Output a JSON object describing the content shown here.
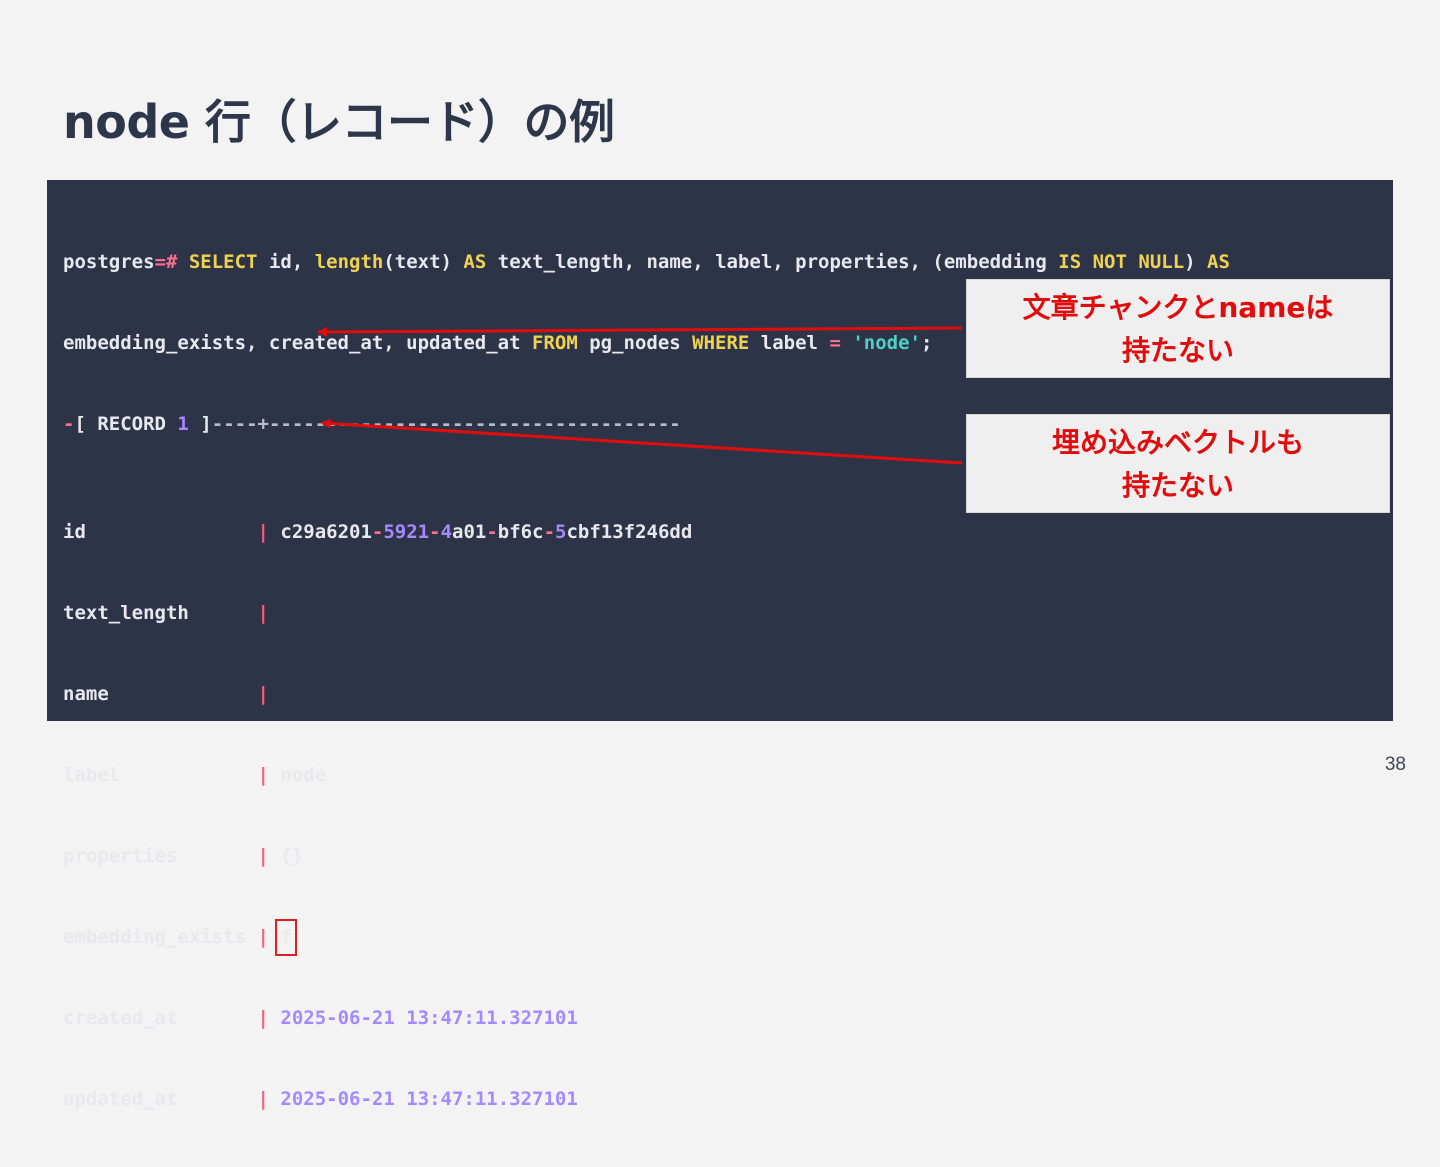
{
  "slide": {
    "title": "node 行（レコード）の例",
    "page_number": "38"
  },
  "terminal": {
    "prompt": "postgres",
    "prompt_op": "=#",
    "query": {
      "select": "SELECT",
      "cols1": " id, ",
      "length": "length",
      "cols2": "(text) ",
      "as1": "AS",
      "cols3": " text_length, name, label, properties, (embedding ",
      "is": "IS",
      "not": "NOT",
      "null": "NULL",
      "paren": ") ",
      "as2": "AS",
      "line2a": "embedding_exists, created_at, updated_at ",
      "from": "FROM",
      "table": " pg_nodes ",
      "where": "WHERE",
      "label_col": " label ",
      "eq": "=",
      "literal": "'node'",
      "semi": ";"
    },
    "record_header": {
      "dash": "-",
      "open": "[ RECORD ",
      "num": "1",
      "close": " ]",
      "rule": "----+------------------------------------"
    },
    "rows": [
      {
        "field": "id               ",
        "value": "c29a6201-5921-4a01-bf6c-5cbf13f246dd"
      },
      {
        "field": "text_length      ",
        "value": ""
      },
      {
        "field": "name             ",
        "value": ""
      },
      {
        "field": "label            ",
        "value": "node"
      },
      {
        "field": "properties       ",
        "value": "{}"
      },
      {
        "field": "embedding_exists ",
        "value": "f"
      },
      {
        "field": "created_at       ",
        "value": "2025-06-21 13:47:11.327101"
      },
      {
        "field": "updated_at       ",
        "value": "2025-06-21 13:47:11.327101"
      }
    ],
    "separator": "|"
  },
  "callouts": [
    {
      "line1": "文章チャンクとnameは",
      "line2": "持たない"
    },
    {
      "line1": "埋め込みベクトルも",
      "line2": "持たない"
    }
  ],
  "colors": {
    "background": "#f3f3f4",
    "terminal": "#2d3448",
    "keyword": "#f0d252",
    "annotation": "#e10d0d"
  }
}
